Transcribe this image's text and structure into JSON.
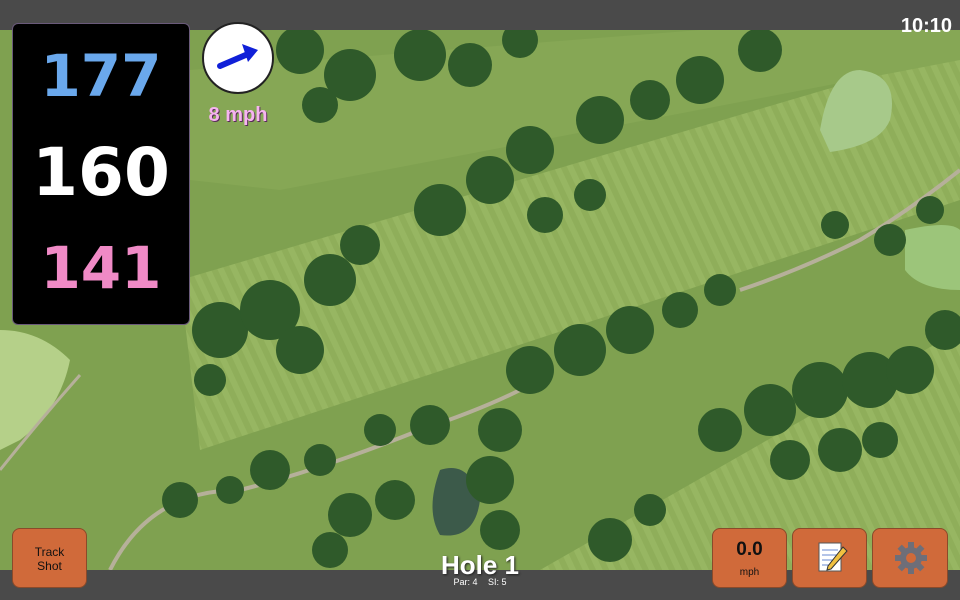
{
  "status_bar": {
    "time": "10:10"
  },
  "yardages": {
    "back": "177",
    "middle": "160",
    "front": "141"
  },
  "wind": {
    "speed_label": "8 mph",
    "direction_icon": "arrow-up-right-icon",
    "color": "#f6b4f0"
  },
  "buttons": {
    "track_shot_line1": "Track",
    "track_shot_line2": "Shot",
    "speed_value": "0.0",
    "speed_unit": "mph",
    "notes_icon": "notepad-icon",
    "settings_icon": "gear-icon",
    "color": "#d06a3a"
  },
  "hole": {
    "title": "Hole 1",
    "par_label": "Par: 4",
    "si_label": "SI: 5"
  },
  "colors": {
    "back_yardage": "#6aa8ec",
    "middle_yardage": "#ffffff",
    "front_yardage": "#f08ac6"
  }
}
